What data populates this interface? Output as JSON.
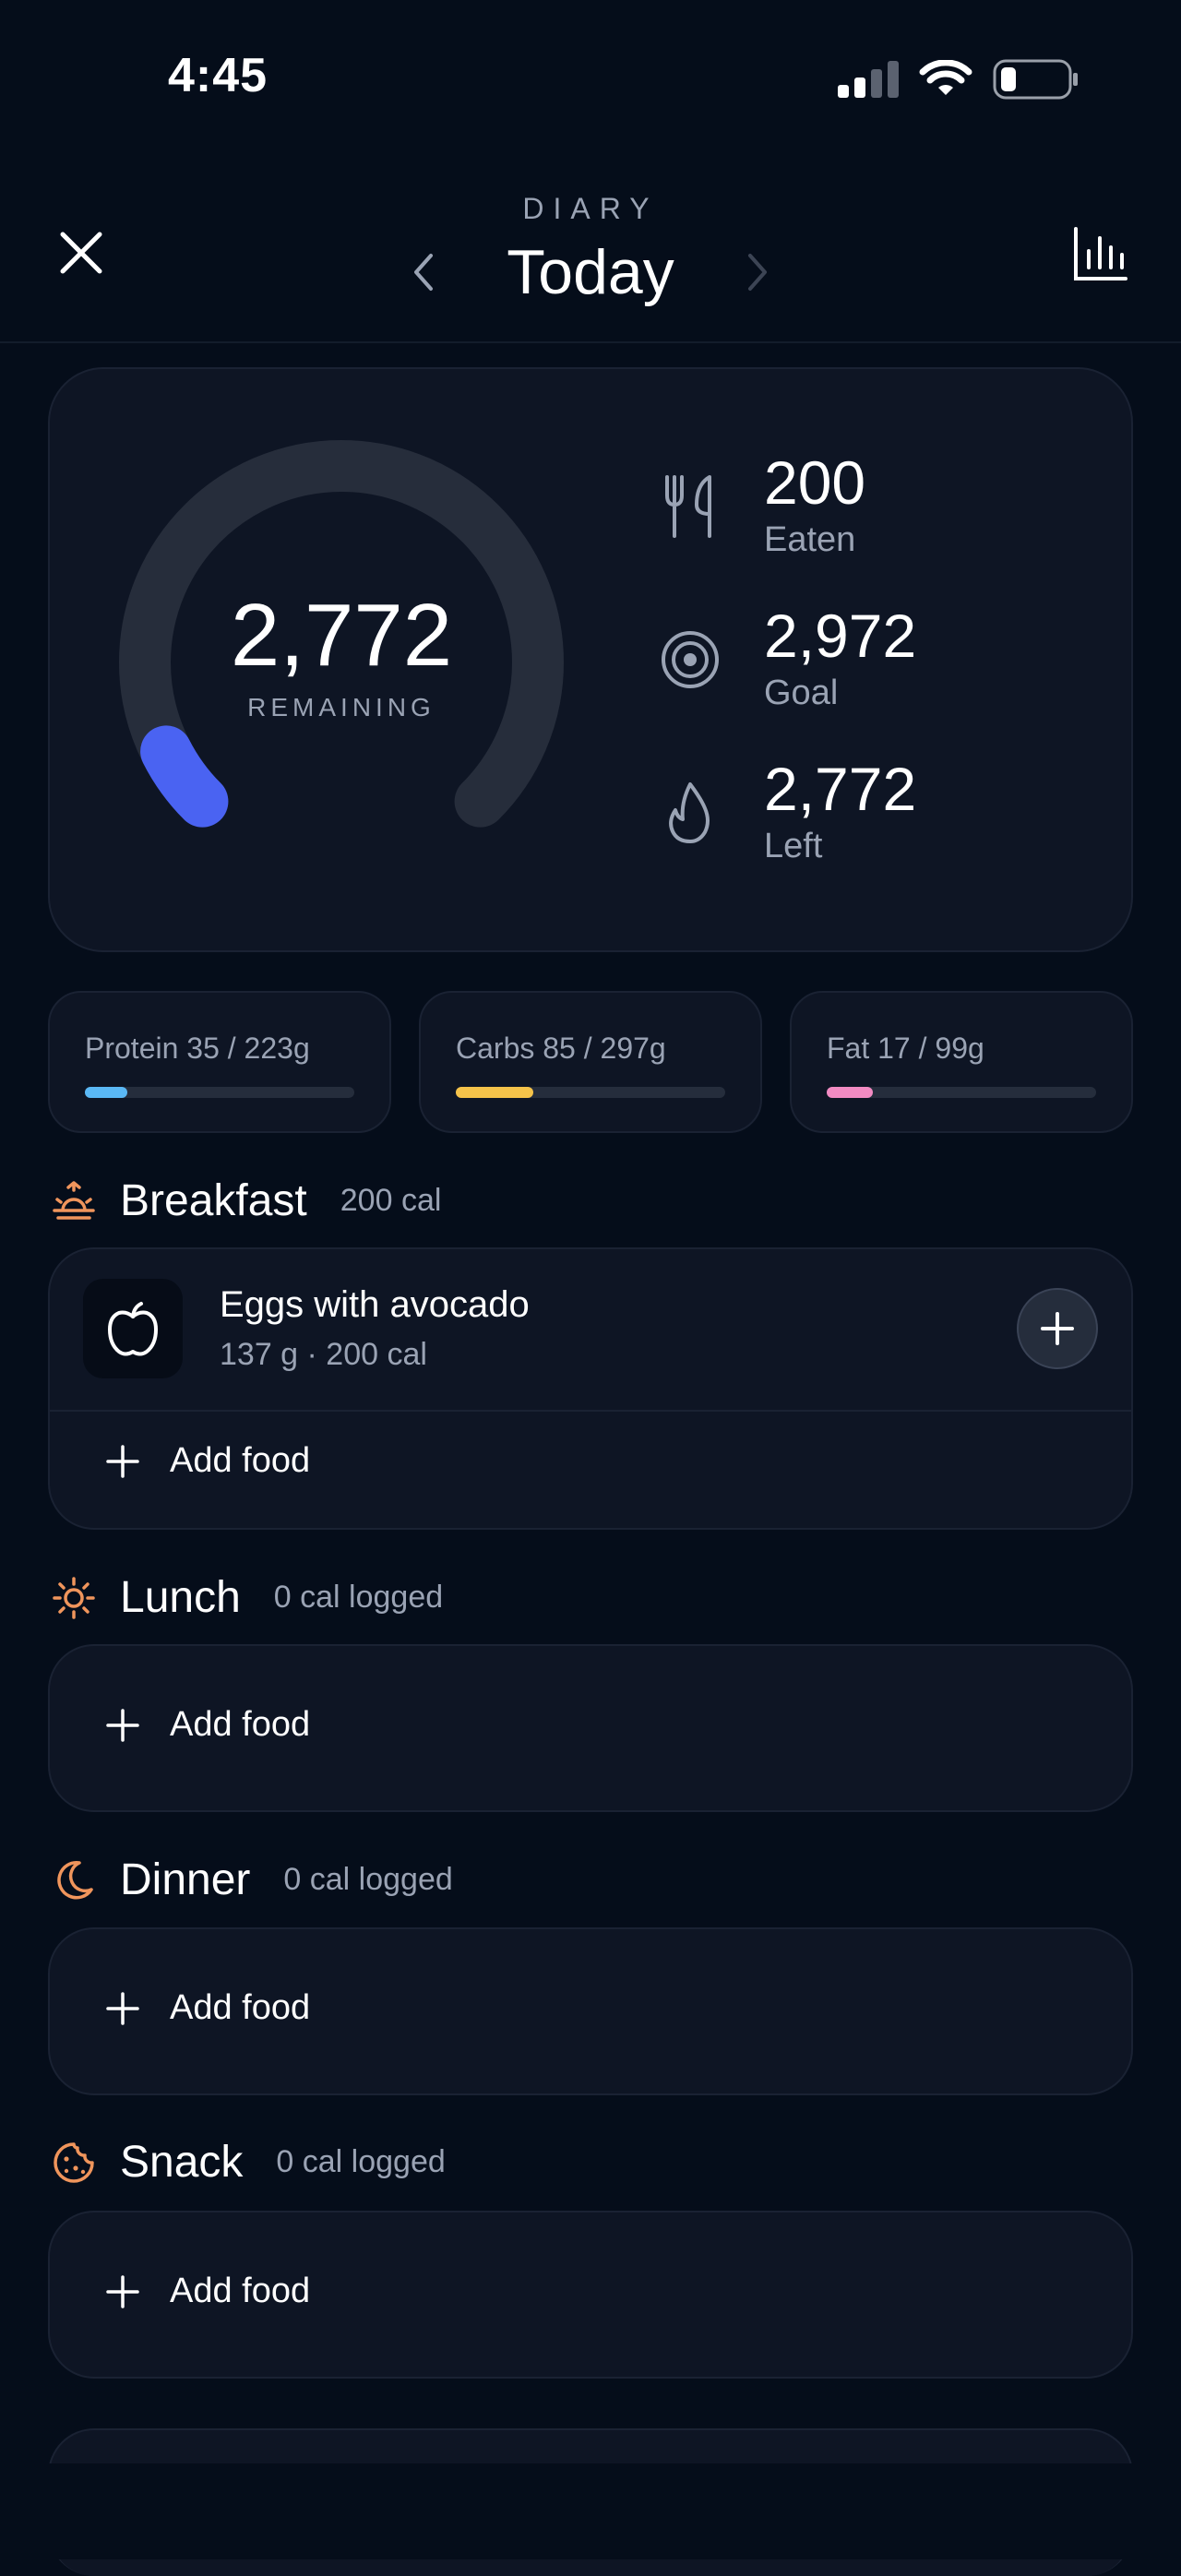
{
  "status_bar": {
    "time": "4:45"
  },
  "header": {
    "section": "DIARY",
    "title": "Today"
  },
  "summary": {
    "remaining_value": "2,772",
    "remaining_label": "REMAINING",
    "progress_fraction": 0.067,
    "stats": [
      {
        "value": "200",
        "label": "Eaten",
        "icon": "fork-knife-icon"
      },
      {
        "value": "2,972",
        "label": "Goal",
        "icon": "target-icon"
      },
      {
        "value": "2,772",
        "label": "Left",
        "icon": "flame-icon"
      }
    ]
  },
  "macros": [
    {
      "label": "Protein 35 / 223g",
      "fraction": 0.157,
      "color": "#5ab8f5"
    },
    {
      "label": "Carbs 85 / 297g",
      "fraction": 0.286,
      "color": "#f5c34a"
    },
    {
      "label": "Fat 17 / 99g",
      "fraction": 0.172,
      "color": "#f28bc3"
    }
  ],
  "meals": [
    {
      "name": "Breakfast",
      "cal": "200 cal",
      "icon": "sunrise-icon",
      "items": [
        {
          "name": "Eggs with avocado",
          "detail": "137 g · 200 cal",
          "icon": "apple-icon"
        }
      ],
      "add_label": "Add food"
    },
    {
      "name": "Lunch",
      "cal": "0 cal logged",
      "icon": "sun-icon",
      "items": [],
      "add_label": "Add food"
    },
    {
      "name": "Dinner",
      "cal": "0 cal logged",
      "icon": "moon-icon",
      "items": [],
      "add_label": "Add food"
    },
    {
      "name": "Snack",
      "cal": "0 cal logged",
      "icon": "cookie-icon",
      "items": [],
      "add_label": "Add food"
    }
  ],
  "colors": {
    "accent": "#4a63f2",
    "meal_icon": "#f0955c",
    "background": "#050d1a",
    "card": "#0e1524"
  }
}
